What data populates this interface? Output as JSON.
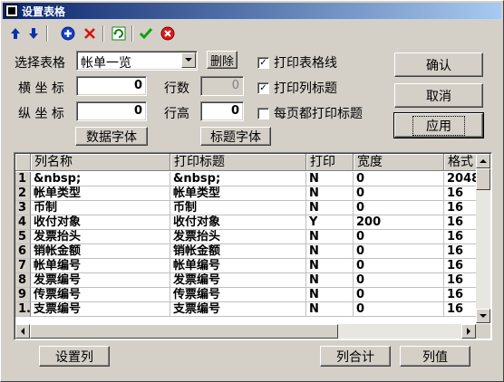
{
  "window": {
    "title": "设置表格"
  },
  "toolbar": {
    "icons": [
      "arrow-up-icon",
      "arrow-down-icon",
      "add-icon",
      "delete-icon",
      "refresh-icon",
      "check-icon",
      "cancel-icon"
    ]
  },
  "form": {
    "select_table_label": "选择表格",
    "select_table_value": "帐单一览",
    "delete_label": "删除",
    "x_coord_label": "横 坐 标",
    "x_coord_value": "0",
    "y_coord_label": "纵 坐 标",
    "y_coord_value": "0",
    "rows_label": "行数",
    "rows_value": "0",
    "row_height_label": "行高",
    "row_height_value": "0",
    "data_font_label": "数据字体",
    "title_font_label": "标题字体",
    "print_gridlines_label": "打印表格线",
    "print_gridlines_checked": true,
    "print_col_titles_label": "打印列标题",
    "print_col_titles_checked": true,
    "print_titles_each_page_label": "每页都打印标题",
    "print_titles_each_page_checked": false,
    "check_mark": "✓"
  },
  "buttons": {
    "ok": "确认",
    "cancel": "取消",
    "apply": "应用",
    "set_column": "设置列",
    "column_total": "列合计",
    "column_value": "列值"
  },
  "grid": {
    "columns": [
      "",
      "列名称",
      "打印标题",
      "打印",
      "宽度",
      "格式"
    ],
    "rows": [
      [
        "1",
        "&nbsp;",
        "&nbsp;",
        "N",
        "0",
        "2048"
      ],
      [
        "2",
        "帐单类型",
        "帐单类型",
        "N",
        "0",
        "16"
      ],
      [
        "3",
        "币制",
        "币制",
        "N",
        "0",
        "16"
      ],
      [
        "4",
        "收付对象",
        "收付对象",
        "Y",
        "200",
        "16"
      ],
      [
        "5",
        "发票抬头",
        "发票抬头",
        "N",
        "0",
        "16"
      ],
      [
        "6",
        "销帐金额",
        "销帐金额",
        "N",
        "0",
        "16"
      ],
      [
        "7",
        "帐单编号",
        "帐单编号",
        "N",
        "0",
        "16"
      ],
      [
        "8",
        "发票编号",
        "发票编号",
        "N",
        "0",
        "16"
      ],
      [
        "9",
        "传票编号",
        "传票编号",
        "N",
        "0",
        "16"
      ],
      [
        "1..",
        "支票编号",
        "支票编号",
        "N",
        "0",
        "16"
      ]
    ]
  }
}
